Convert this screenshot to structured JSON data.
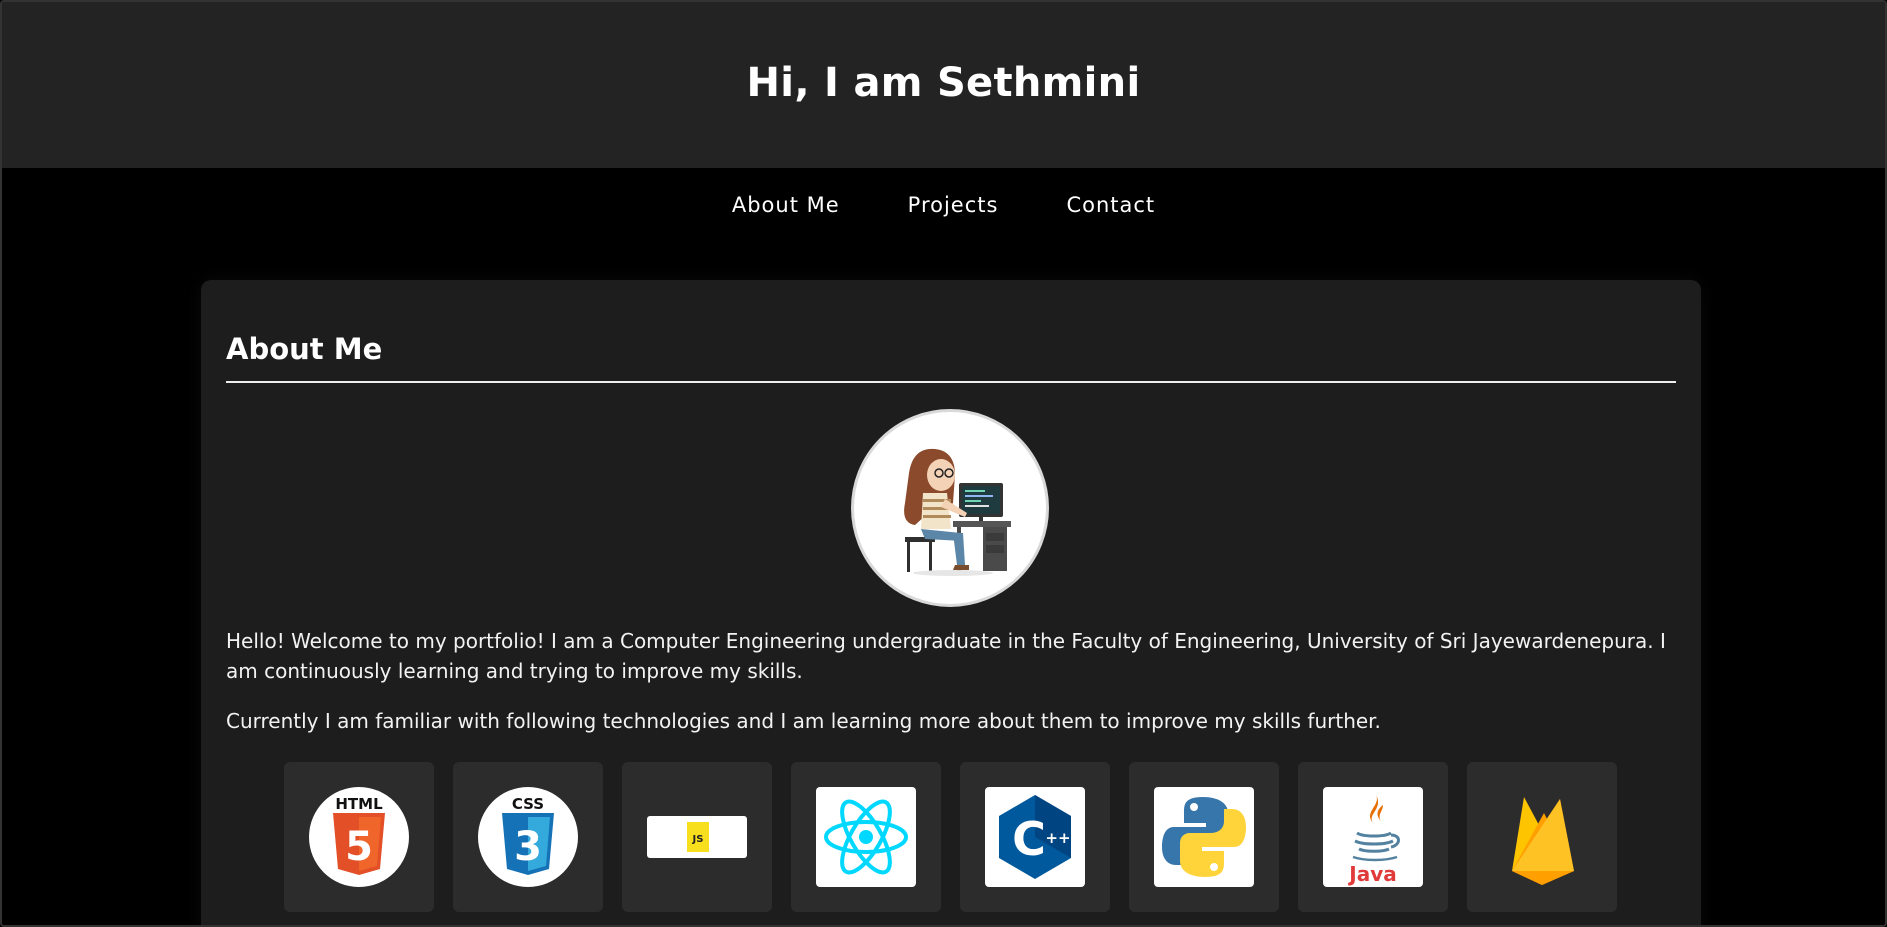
{
  "header": {
    "title": "Hi, I am Sethmini"
  },
  "nav": {
    "items": [
      {
        "label": "About Me"
      },
      {
        "label": "Projects"
      },
      {
        "label": "Contact"
      }
    ]
  },
  "about": {
    "heading": "About Me",
    "avatar_icon": "girl-coding-avatar-icon",
    "paragraph1": "Hello! Welcome to my portfolio! I am a Computer Engineering undergraduate in the Faculty of Engineering, University of Sri Jayewardenepura. I am continuously learning and trying to improve my skills.",
    "paragraph2": "Currently I am familiar with following technologies and I am learning more about them to improve my skills further.",
    "technologies": [
      {
        "icon": "html5-icon",
        "logo_text": "HTML",
        "logo_glyph": "5"
      },
      {
        "icon": "css3-icon",
        "logo_text": "CSS",
        "logo_glyph": "3"
      },
      {
        "icon": "javascript-icon",
        "logo_text": "JS"
      },
      {
        "icon": "react-icon"
      },
      {
        "icon": "cpp-icon",
        "logo_glyph": "C",
        "logo_text": "++"
      },
      {
        "icon": "python-icon"
      },
      {
        "icon": "java-icon",
        "logo_text": "Java"
      },
      {
        "icon": "firebase-icon"
      }
    ]
  },
  "colors": {
    "page_bg": "#000000",
    "header_bg": "#232323",
    "card_bg": "#1d1d1d",
    "tile_bg": "#2c2c2c",
    "html_orange": "#e34f26",
    "css_blue": "#1572b6",
    "js_yellow": "#f7df1e",
    "react_cyan": "#00d8ff",
    "cpp_blue": "#00599c",
    "python_blue": "#3776ab",
    "python_yellow": "#ffd43b",
    "java_red": "#e76f00",
    "firebase_orange": "#ffa000"
  }
}
